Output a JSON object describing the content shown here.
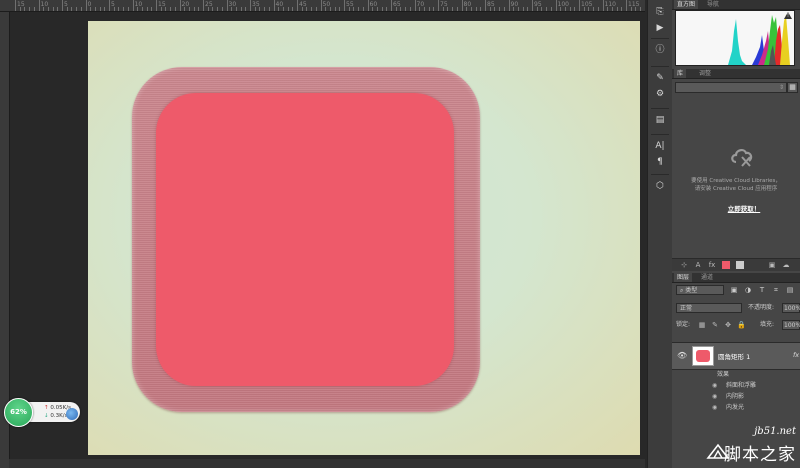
{
  "ruler": {
    "ticks": [
      "15",
      "10",
      "5",
      "0",
      "5",
      "10",
      "15",
      "20",
      "25",
      "30",
      "35",
      "40",
      "45",
      "50",
      "55",
      "60",
      "65",
      "70",
      "75",
      "80",
      "85",
      "90",
      "95",
      "100",
      "105",
      "110",
      "115"
    ]
  },
  "speed_widget": {
    "percent": "62%",
    "upload": "0.05K/s",
    "download": "0.3K/s"
  },
  "tools": {
    "icons": [
      "history-icon",
      "play-icon",
      "info-icon",
      "brush-icon",
      "adjust-icon",
      "properties-icon",
      "character-icon",
      "paragraph-icon",
      "3d-icon"
    ],
    "glyphs": [
      "⎘",
      "▶",
      "ⓘ",
      "✎",
      "⚙",
      "▤",
      "A|",
      "¶",
      "⬡"
    ]
  },
  "histogram_panel": {
    "tabs": [
      "直方图",
      "导航"
    ]
  },
  "libraries_panel": {
    "tabs": [
      "库",
      "调整"
    ],
    "cc_line1": "要使用 Creative Cloud Libraries，",
    "cc_line2": "请安装 Creative Cloud 应用程序",
    "link": "立即获取！"
  },
  "layers_panel": {
    "tabs": [
      "图层",
      "通道"
    ],
    "filter_kind": "类型",
    "blend_mode": "正常",
    "opacity_label": "不透明度:",
    "opacity_value": "100%",
    "lock_label": "锁定:",
    "fill_label": "填充:",
    "fill_value": "100%",
    "layer_name": "圆角矩形 1",
    "fx": "fx",
    "effects_label": "效果",
    "effects": [
      "斜面和浮雕",
      "内阴影",
      "内发光"
    ]
  },
  "watermark": {
    "url": "jb51.net",
    "text": "脚本之家"
  },
  "colors": {
    "inner_rect": "#ee5a6a",
    "outer_rect": "#c98088",
    "canvas_bg": "#d4e6cf"
  }
}
